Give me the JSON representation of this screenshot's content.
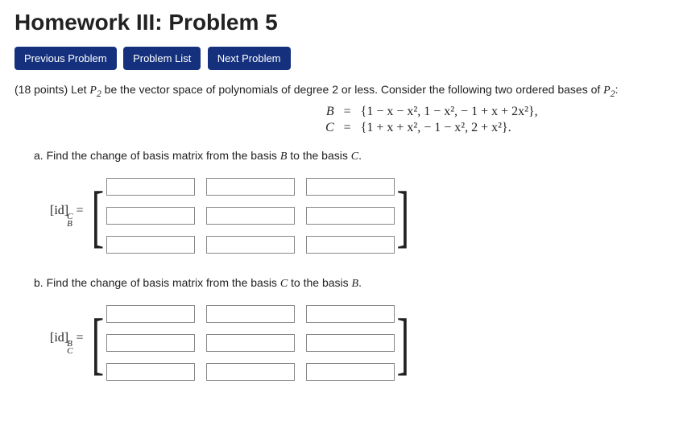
{
  "title": "Homework III: Problem 5",
  "nav": {
    "prev": "Previous Problem",
    "list": "Problem List",
    "next": "Next Problem"
  },
  "points": "(18 points) ",
  "intro_a": "Let ",
  "intro_b": " be the vector space of polynomials of degree ",
  "intro_deg": "2",
  "intro_c": " or less. Consider the following two ordered bases of ",
  "intro_d": ":",
  "basis": {
    "B_sym": "B",
    "C_sym": "C",
    "eq": "=",
    "B_set": "{1 − x − x²,  1 − x²,  − 1 + x + 2x²},",
    "C_set": "{1 + x + x²,  − 1 − x²,  2 + x²}."
  },
  "part_a": "a. Find the change of basis matrix from the basis ",
  "part_a_mid": " to the basis ",
  "part_a_end": ".",
  "part_b": "b. Find the change of basis matrix from the basis ",
  "part_b_mid": " to the basis ",
  "part_b_end": ".",
  "label_id": "[id]",
  "eq_sign": " = ",
  "sup_C": "C",
  "sub_B": "B",
  "sup_B": "B",
  "sub_C": "C",
  "P2": "P",
  "P2_sub": "2",
  "calB": "B",
  "calC": "C"
}
